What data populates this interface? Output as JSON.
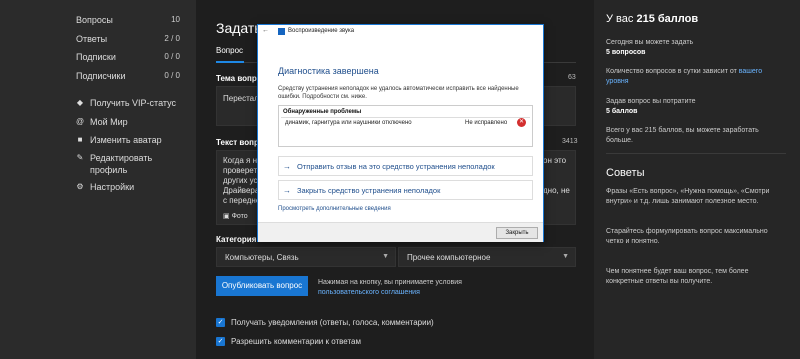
{
  "sidebar": {
    "stats": [
      {
        "label": "Вопросы",
        "count": "10"
      },
      {
        "label": "Ответы",
        "count": "2 / 0"
      },
      {
        "label": "Подписки",
        "count": "0 / 0"
      },
      {
        "label": "Подписчики",
        "count": "0 / 0"
      }
    ],
    "nav": [
      {
        "label": "Получить VIP-статус",
        "icon": "vip-icon"
      },
      {
        "label": "Мой Мир",
        "icon": "mir-icon"
      },
      {
        "label": "Изменить аватар",
        "icon": "camera-icon"
      },
      {
        "label": "Редактировать профиль",
        "icon": "edit-icon"
      },
      {
        "label": "Настройки",
        "icon": "gear-icon"
      }
    ]
  },
  "main": {
    "title": "Задать",
    "tab": "Вопрос",
    "topic_label": "Тема вопрос",
    "topic_count": "63",
    "topic_value": "Перестал",
    "text_label": "Текст вопр",
    "text_count": "3413",
    "text_lines": [
      "Когда я на",
      "проверет",
      "других уст",
      "Драйвера",
      "с передне"
    ],
    "text_right_lines": [
      "он это",
      "",
      "",
      "дно, не",
      ""
    ],
    "photo_label": "Фото",
    "category_label": "Категория",
    "category_value": "Компьютеры, Связь",
    "subcategory_value": "Прочее компьютерное",
    "publish_label": "Опубликовать вопрос",
    "publish_note_1": "Нажимая на кнопку, вы принимаете условия",
    "publish_note_link": "пользовательского соглашения",
    "check_1": "Получать уведомления (ответы, голоса, комментарии)",
    "check_2": "Разрешить комментарии к ответам"
  },
  "right": {
    "score_prefix": "У вас",
    "score_value": "215 баллов",
    "p1_a": "Сегодня вы можете задать",
    "p1_b": "5 вопросов",
    "p2_a": "Количество вопросов в сутки зависит от",
    "p2_link": "вашего уровня",
    "p3_a": "Задав вопрос вы потратите",
    "p3_b": "5 баллов",
    "p4": "Всего у вас 215 баллов, вы можете заработать больше.",
    "tips_title": "Советы",
    "tip1": "Фразы «Есть вопрос», «Нужна помощь», «Смотри внутри» и т.д. лишь занимают полезное место.",
    "tip2": "Старайтесь формулировать вопрос максимально четко и понятно.",
    "tip3": "Чем понятнее будет ваш вопрос, тем более конкретные ответы вы получите."
  },
  "dialog": {
    "window_title": "Воспроизведение звука",
    "heading": "Диагностика завершена",
    "description": "Средству устранения неполадок не удалось автоматически исправить все найденные ошибки. Подробности см. ниже.",
    "problems_header": "Обнаруженные проблемы",
    "problem_name": "динамик, гарнитура или наушники отключено",
    "problem_status": "Не исправлено",
    "link_feedback": "Отправить отзыв на это средство устранения неполадок",
    "link_close": "Закрыть средство устранения неполадок",
    "more_info": "Просмотреть дополнительные сведения",
    "close_button": "Закрыть"
  },
  "colors": {
    "accent": "#1976d2",
    "link": "#6ab4ff",
    "error": "#d32f2f"
  }
}
